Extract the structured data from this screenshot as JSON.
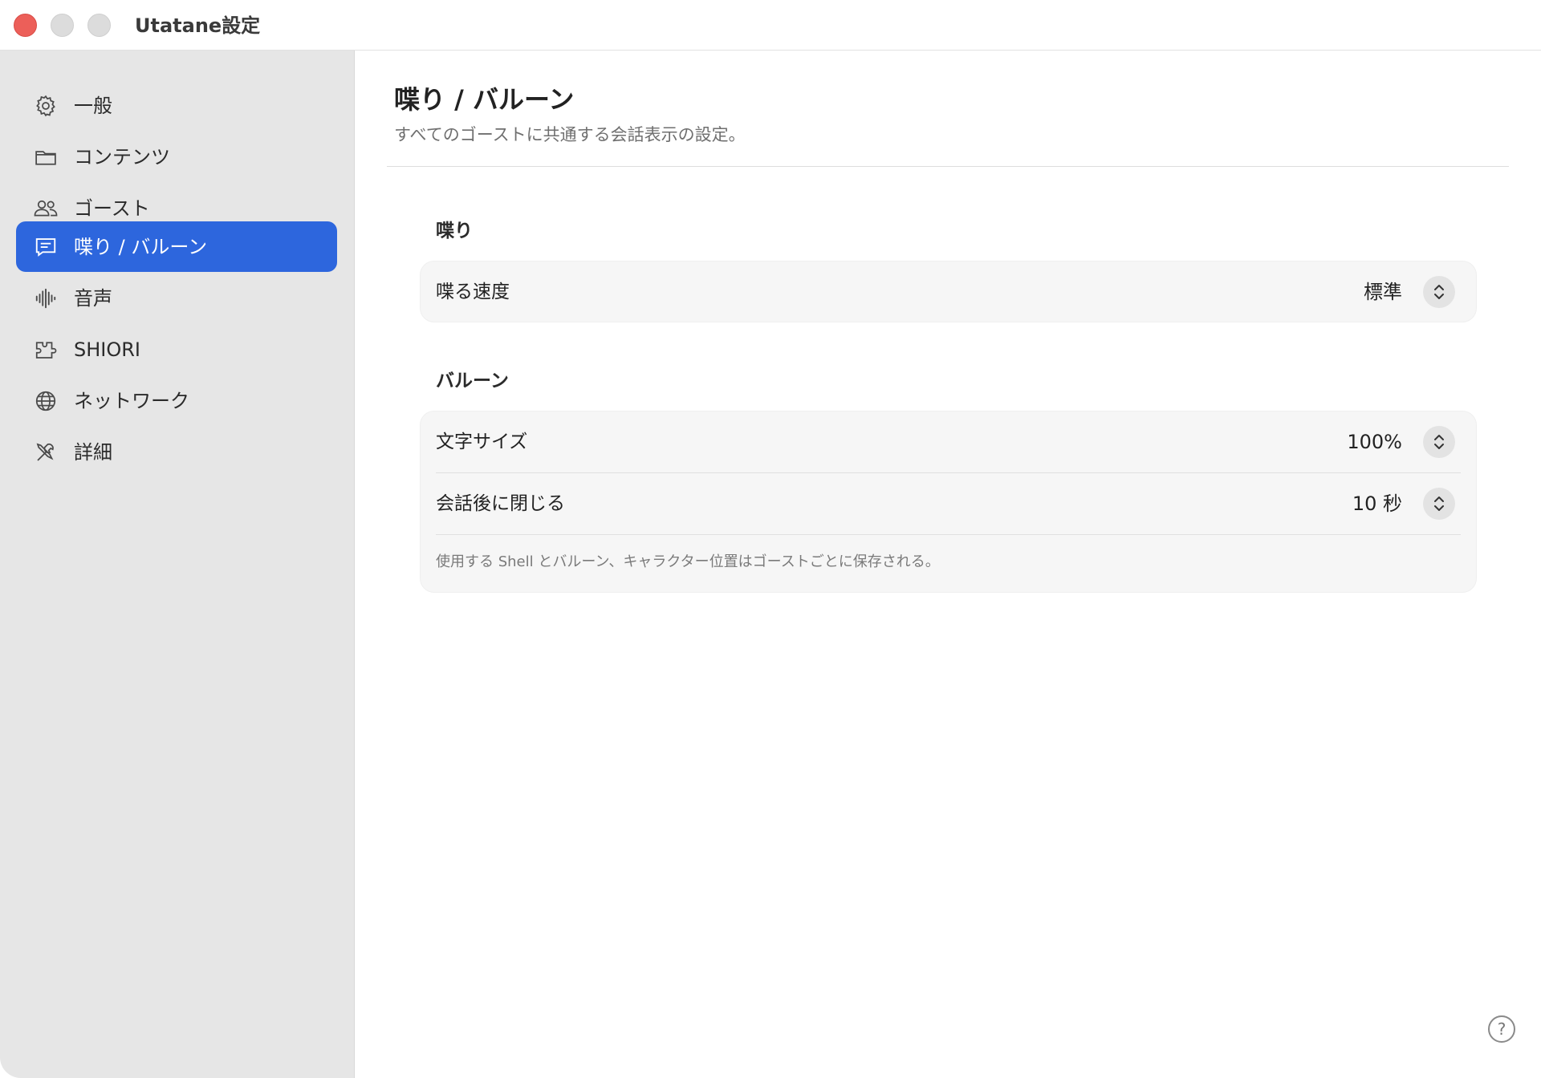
{
  "window": {
    "title": "Utatane設定"
  },
  "sidebar": {
    "items": [
      {
        "label": "一般",
        "icon": "gear-icon"
      },
      {
        "label": "コンテンツ",
        "icon": "folder-icon"
      },
      {
        "label": "ゴースト",
        "icon": "people-icon"
      },
      {
        "label": "喋り / バルーン",
        "icon": "speech-bubble-icon",
        "active": true
      },
      {
        "label": "音声",
        "icon": "waveform-icon"
      },
      {
        "label": "SHIORI",
        "icon": "puzzle-icon"
      },
      {
        "label": "ネットワーク",
        "icon": "globe-icon"
      },
      {
        "label": "詳細",
        "icon": "tools-icon"
      }
    ]
  },
  "main": {
    "title": "喋り / バルーン",
    "subtitle": "すべてのゴーストに共通する会話表示の設定。",
    "sections": [
      {
        "title": "喋り",
        "rows": [
          {
            "label": "喋る速度",
            "value": "標準"
          }
        ]
      },
      {
        "title": "バルーン",
        "rows": [
          {
            "label": "文字サイズ",
            "value": "100%"
          },
          {
            "label": "会話後に閉じる",
            "value": "10 秒"
          }
        ],
        "note": "使用する Shell とバルーン、キャラクター位置はゴーストごとに保存される。"
      }
    ],
    "help_label": "?"
  },
  "colors": {
    "accent": "#2d66dd",
    "close": "#ec5f59",
    "sidebar_bg": "#e6e6e6",
    "group_bg": "#f6f6f6"
  }
}
